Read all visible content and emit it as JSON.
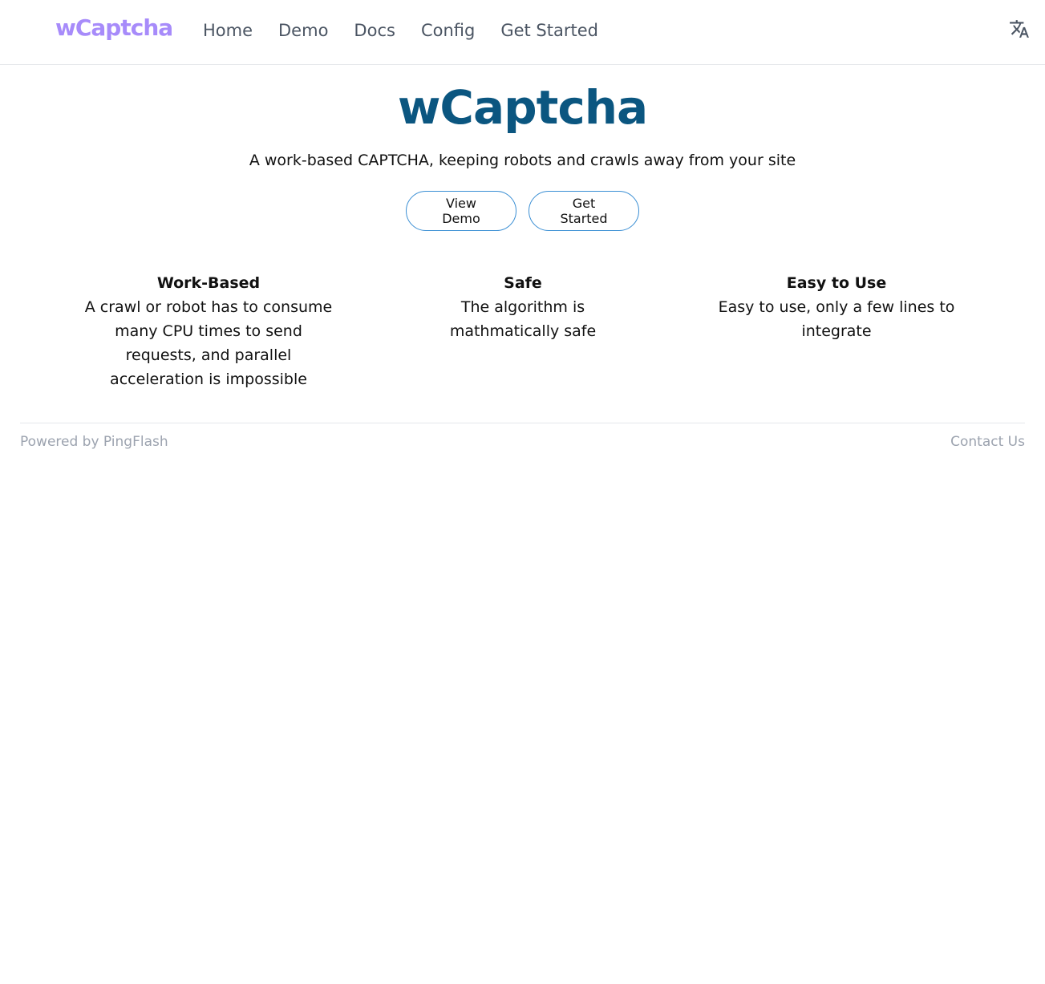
{
  "navbar": {
    "brand": "wCaptcha",
    "links": [
      "Home",
      "Demo",
      "Docs",
      "Config",
      "Get Started"
    ],
    "translate_icon": "translate-icon"
  },
  "hero": {
    "title": "wCaptcha",
    "subtitle": "A work-based CAPTCHA, keeping robots and crawls away from your site",
    "actions": [
      "View Demo",
      "Get Started"
    ]
  },
  "features": [
    {
      "title": "Work-Based",
      "description": "A crawl or robot has to consume many CPU times to send requests, and parallel acceleration is impossible"
    },
    {
      "title": "Safe",
      "description": "The algorithm is mathmatically safe"
    },
    {
      "title": "Easy to Use",
      "description": "Easy to use, only a few lines to integrate"
    }
  ],
  "footer": {
    "powered_by": "Powered by PingFlash",
    "contact": "Contact Us"
  },
  "colors": {
    "brand": "#a78bfa",
    "hero_title": "#0b5680",
    "button_border": "#3b8fd4",
    "nav_text": "#4b5563",
    "footer_text": "#9ca3af"
  }
}
